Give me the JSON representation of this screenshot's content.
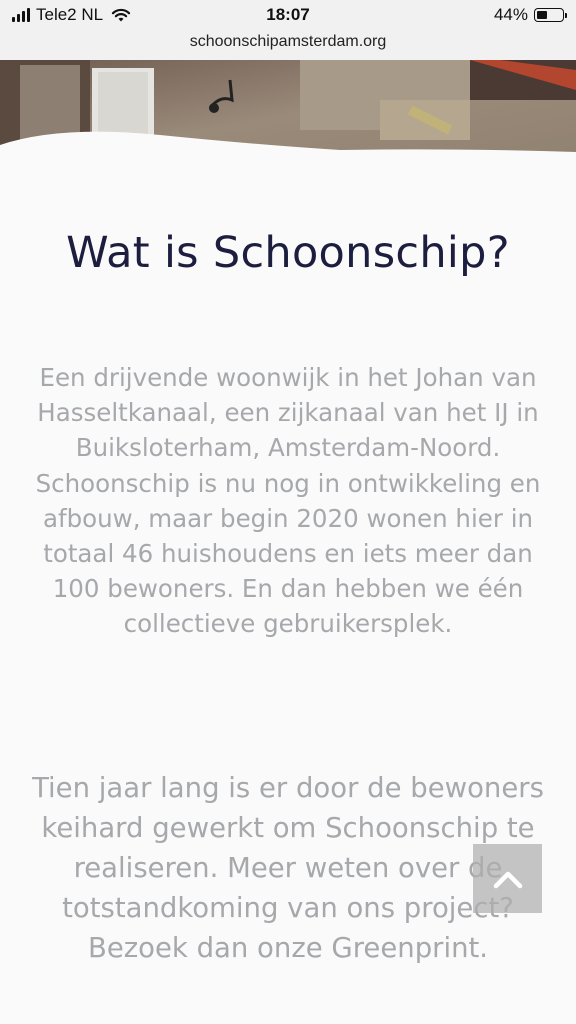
{
  "status_bar": {
    "carrier": "Tele2 NL",
    "time": "18:07",
    "battery_percent": "44%",
    "battery_level": 0.44
  },
  "browser": {
    "url": "schoonschipamsterdam.org"
  },
  "main": {
    "title": "Wat is Schoonschip?",
    "paragraphs": [
      "Een drijvende woonwijk in het Johan van Hasseltkanaal, een zijkanaal van het IJ in Buiksloterham, Amsterdam-Noord. Schoonschip is nu nog in ontwikkeling en afbouw, maar begin 2020 wonen hier in totaal 46 huishoudens en iets meer dan 100 bewoners. En dan hebben we één collectieve gebruikersplek.",
      "Tien jaar lang is er door de bewoners keihard gewerkt om Schoonschip te realiseren. Meer weten over de totstandkoming van ons project? Bezoek dan onze Greenprint."
    ]
  },
  "icons": {
    "wifi": "wifi-icon",
    "signal": "cellular-signal-icon",
    "battery": "battery-icon",
    "scroll_top": "chevron-up-icon"
  },
  "colors": {
    "title": "#1d1e3f",
    "body_text": "#a6a8ab",
    "background": "#fafafa",
    "status_bar": "#f1f1f1"
  }
}
